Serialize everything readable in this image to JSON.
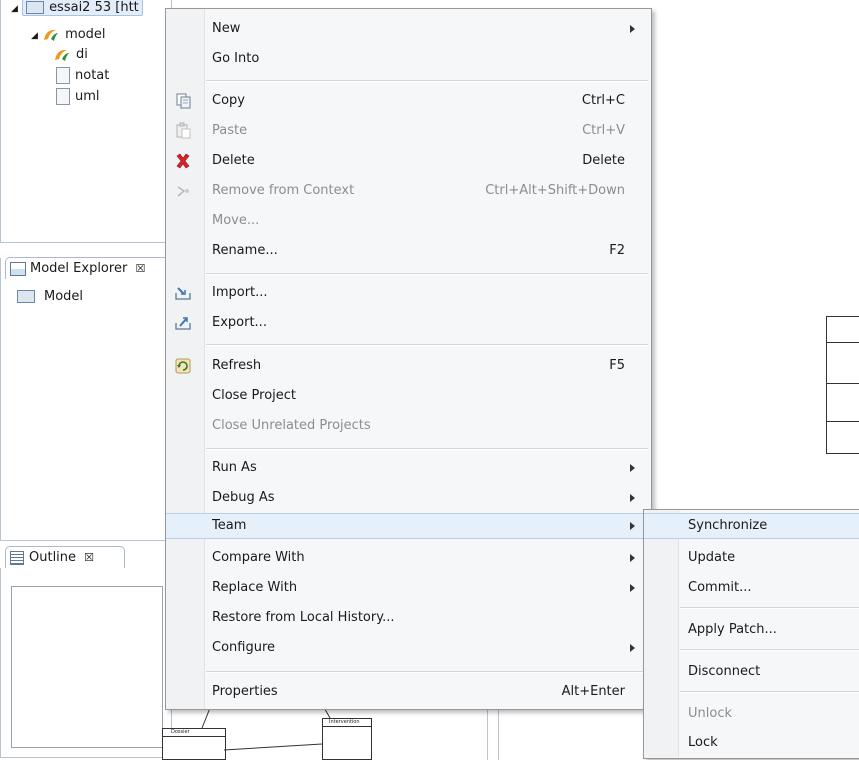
{
  "project_explorer": {
    "project_label": "essai2 53 [htt",
    "model_label": "model",
    "items": [
      "di",
      "notat",
      "uml"
    ]
  },
  "model_explorer": {
    "tab_label": "Model Explorer",
    "tab_close": "☒",
    "root": "Model"
  },
  "outline": {
    "tab_label": "Outline",
    "tab_close": "☒"
  },
  "diagram": {
    "class_left": "Dossier",
    "class_right": "Intervention"
  },
  "context_menu": {
    "items": {
      "new": {
        "label": "New"
      },
      "go_into": {
        "label": "Go Into"
      },
      "copy": {
        "label": "Copy",
        "shortcut": "Ctrl+C"
      },
      "paste": {
        "label": "Paste",
        "shortcut": "Ctrl+V"
      },
      "delete": {
        "label": "Delete",
        "shortcut": "Delete"
      },
      "remove_from_context": {
        "label": "Remove from Context",
        "shortcut": "Ctrl+Alt+Shift+Down"
      },
      "move": {
        "label": "Move..."
      },
      "rename": {
        "label": "Rename...",
        "shortcut": "F2"
      },
      "import": {
        "label": "Import..."
      },
      "export": {
        "label": "Export..."
      },
      "refresh": {
        "label": "Refresh",
        "shortcut": "F5"
      },
      "close_project": {
        "label": "Close Project"
      },
      "close_unrelated": {
        "label": "Close Unrelated Projects"
      },
      "run_as": {
        "label": "Run As"
      },
      "debug_as": {
        "label": "Debug As"
      },
      "team": {
        "label": "Team"
      },
      "compare_with": {
        "label": "Compare With"
      },
      "replace_with": {
        "label": "Replace With"
      },
      "restore_local_history": {
        "label": "Restore from Local History..."
      },
      "configure": {
        "label": "Configure"
      },
      "properties": {
        "label": "Properties",
        "shortcut": "Alt+Enter"
      }
    }
  },
  "team_submenu": {
    "items": {
      "synchronize": {
        "label": "Synchronize"
      },
      "update": {
        "label": "Update"
      },
      "commit": {
        "label": "Commit..."
      },
      "apply_patch": {
        "label": "Apply Patch..."
      },
      "disconnect": {
        "label": "Disconnect"
      },
      "unlock": {
        "label": "Unlock"
      },
      "lock": {
        "label": "Lock"
      }
    }
  },
  "colors": {
    "delete_icon": "#d3232b",
    "model_icon": "#ee9a1a",
    "highlight": "#e6f0fb"
  }
}
